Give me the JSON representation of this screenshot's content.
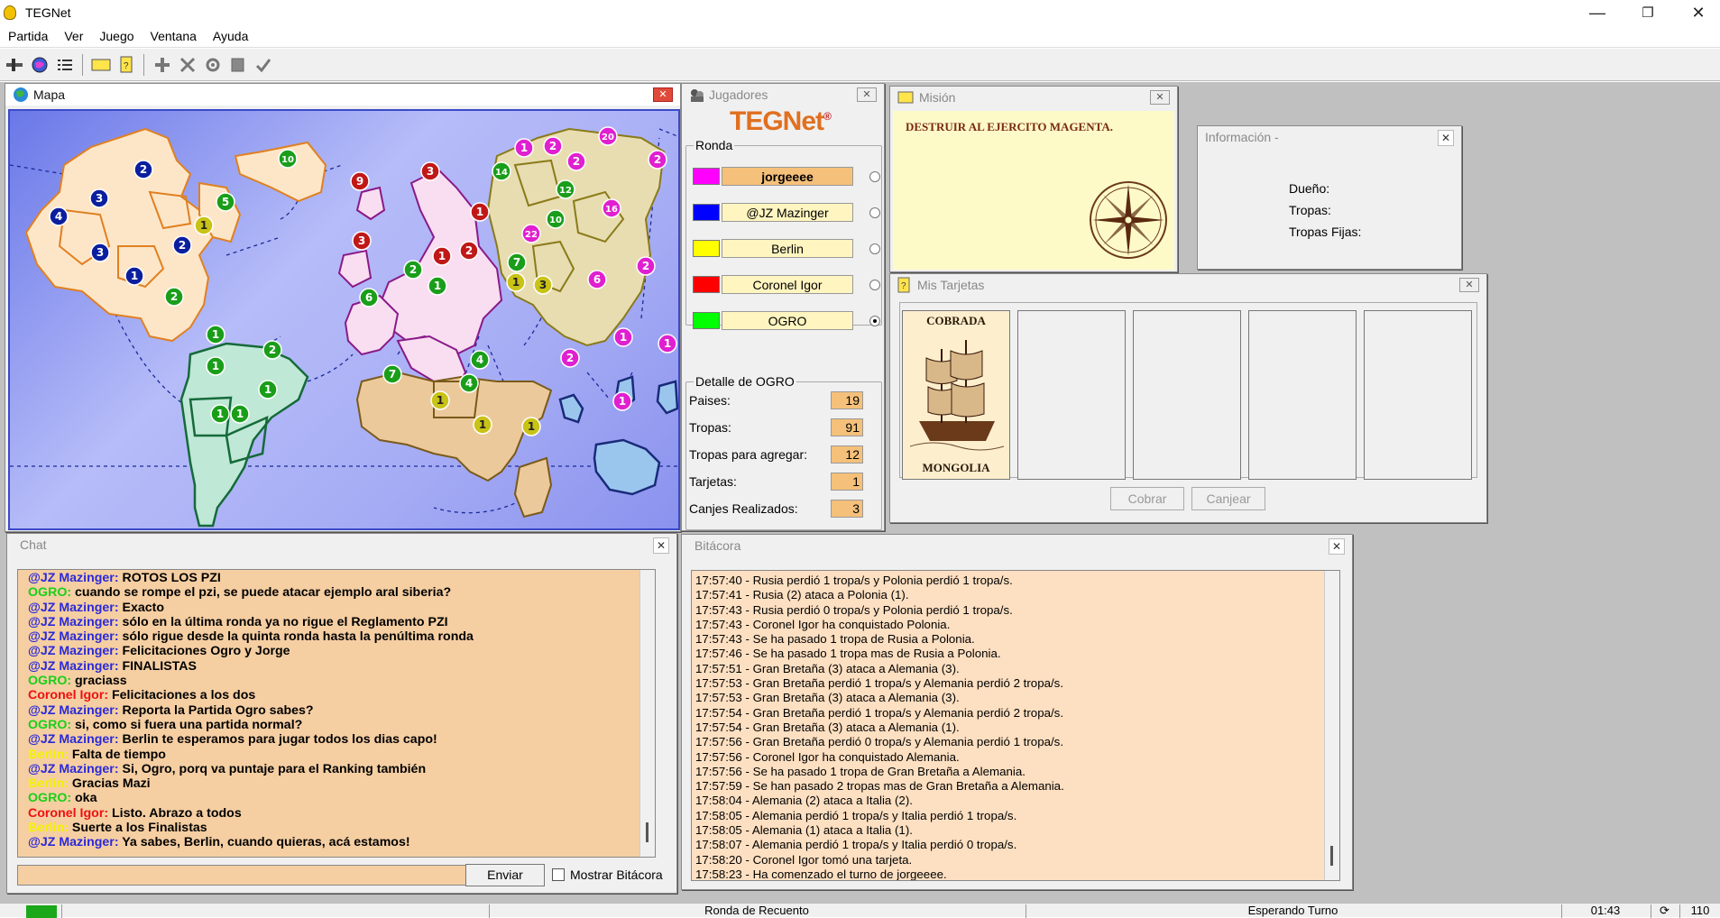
{
  "window": {
    "title": "TEGNet",
    "minimize": "—",
    "restore": "❐",
    "close": "✕"
  },
  "menu": [
    "Partida",
    "Ver",
    "Juego",
    "Ventana",
    "Ayuda"
  ],
  "map_window": {
    "title": "Mapa"
  },
  "players_window": {
    "title": "Jugadores",
    "logo": "TEGNet",
    "logo_mark": "®",
    "round_label": "Ronda",
    "players": [
      {
        "name": "jorgeeee",
        "color": "#ff00ff",
        "current": true,
        "selected": false
      },
      {
        "name": "@JZ Mazinger",
        "color": "#0000ff",
        "current": false,
        "selected": false
      },
      {
        "name": "Berlin",
        "color": "#ffff00",
        "current": false,
        "selected": false
      },
      {
        "name": "Coronel Igor",
        "color": "#ff0000",
        "current": false,
        "selected": false
      },
      {
        "name": "OGRO",
        "color": "#00ff00",
        "current": false,
        "selected": true
      }
    ],
    "detail_label": "Detalle de OGRO",
    "details": [
      {
        "label": "Paises:",
        "value": "19"
      },
      {
        "label": "Tropas:",
        "value": "91"
      },
      {
        "label": "Tropas para agregar:",
        "value": "12"
      },
      {
        "label": "Tarjetas:",
        "value": "1"
      },
      {
        "label": "Canjes Realizados:",
        "value": "3"
      }
    ]
  },
  "mission_window": {
    "title": "Misión",
    "text": "DESTRUIR AL EJERCITO MAGENTA."
  },
  "info_window": {
    "title": "Información -",
    "owner_label": "Dueño:",
    "troops_label": "Tropas:",
    "fixed_troops_label": "Tropas Fijas:"
  },
  "cards_window": {
    "title": "Mis Tarjetas",
    "card": {
      "top": "COBRADA",
      "bottom": "MONGOLIA"
    },
    "cobrar_button": "Cobrar",
    "canjear_button": "Canjear"
  },
  "chat_window": {
    "title": "Chat",
    "messages": [
      {
        "author": "@JZ Mazinger:",
        "text": " ROTOS LOS PZI",
        "color": "#2a2ad8"
      },
      {
        "author": "OGRO:",
        "text": " cuando se rompe el pzi, se puede atacar ejemplo aral siberia?",
        "color": "#18d018"
      },
      {
        "author": "@JZ Mazinger:",
        "text": " Exacto",
        "color": "#2a2ad8"
      },
      {
        "author": "@JZ Mazinger:",
        "text": " sólo en la última ronda ya no rigue el Reglamento PZI",
        "color": "#2a2ad8"
      },
      {
        "author": "@JZ Mazinger:",
        "text": " sólo rigue desde la quinta ronda hasta la penúltima ronda",
        "color": "#2a2ad8"
      },
      {
        "author": "@JZ Mazinger:",
        "text": " Felicitaciones Ogro y Jorge",
        "color": "#2a2ad8"
      },
      {
        "author": "@JZ Mazinger:",
        "text": " FINALISTAS",
        "color": "#2a2ad8"
      },
      {
        "author": "OGRO:",
        "text": " graciass",
        "color": "#18d018"
      },
      {
        "author": "Coronel Igor:",
        "text": " Felicitaciones a los dos",
        "color": "#ee1111"
      },
      {
        "author": "@JZ Mazinger:",
        "text": " Reporta la Partida Ogro sabes?",
        "color": "#2a2ad8"
      },
      {
        "author": "OGRO:",
        "text": " si, como si fuera una partida normal?",
        "color": "#18d018"
      },
      {
        "author": "@JZ Mazinger:",
        "text": " Berlin te esperamos para jugar todos los dias capo!",
        "color": "#2a2ad8"
      },
      {
        "author": "Berlin:",
        "text": " Falta de tiempo",
        "color": "#f4f400"
      },
      {
        "author": "@JZ Mazinger:",
        "text": " Si, Ogro, porq va puntaje para el Ranking también",
        "color": "#2a2ad8"
      },
      {
        "author": "Berlin:",
        "text": " Gracias Mazi",
        "color": "#f4f400"
      },
      {
        "author": "OGRO:",
        "text": " oka",
        "color": "#18d018"
      },
      {
        "author": "Coronel Igor:",
        "text": " Listo. Abrazo a todos",
        "color": "#ee1111"
      },
      {
        "author": "Berlin:",
        "text": " Suerte a los Finalistas",
        "color": "#f4f400"
      },
      {
        "author": "@JZ Mazinger:",
        "text": " Ya sabes, Berlin, cuando quieras, acá estamos!",
        "color": "#2a2ad8"
      }
    ],
    "input_value": "",
    "send_button": "Enviar",
    "show_log_label": "Mostrar Bitácora"
  },
  "log_window": {
    "title": "Bitácora",
    "entries": [
      "17:57:40 - Rusia perdió 1 tropa/s y Polonia perdió 1 tropa/s.",
      "17:57:41 - Rusia (2) ataca a Polonia (1).",
      "17:57:43 - Rusia perdió 0 tropa/s y Polonia perdió 1 tropa/s.",
      "17:57:43 - Coronel Igor ha conquistado Polonia.",
      "17:57:43 - Se ha pasado 1 tropa de Rusia a Polonia.",
      "17:57:46 - Se ha pasado 1 tropa mas de Rusia a Polonia.",
      "17:57:51 - Gran Bretaña (3) ataca a Alemania (3).",
      "17:57:53 - Gran Bretaña perdió 1 tropa/s y Alemania perdió 2 tropa/s.",
      "17:57:53 - Gran Bretaña (3) ataca a Alemania (3).",
      "17:57:54 - Gran Bretaña perdió 1 tropa/s y Alemania perdió 2 tropa/s.",
      "17:57:54 - Gran Bretaña (3) ataca a Alemania (1).",
      "17:57:56 - Gran Bretaña perdió 0 tropa/s y Alemania perdió 1 tropa/s.",
      "17:57:56 - Coronel Igor ha conquistado Alemania.",
      "17:57:56 - Se ha pasado 1 tropa de Gran Bretaña a Alemania.",
      "17:57:59 - Se han pasado 2 tropas mas de Gran Bretaña a Alemania.",
      "17:58:04 - Alemania (2) ataca a Italia (2).",
      "17:58:05 - Alemania perdió 1 tropa/s y Italia perdió 1 tropa/s.",
      "17:58:05 - Alemania (1) ataca a Italia (1).",
      "17:58:07 - Alemania perdió 1 tropa/s y Italia perdió 0 tropa/s.",
      "17:58:20 - Coronel Igor tomó una tarjeta.",
      "17:58:23 - Ha comenzado el turno de jorgeeee."
    ]
  },
  "statusbar": {
    "phase": "Ronda de Recuento",
    "state": "Esperando Turno",
    "time": "01:43",
    "count": "110"
  },
  "map": {
    "armies": [
      {
        "n": "2",
        "c": "#0b1f9e"
      },
      {
        "n": "3",
        "c": "#0b1f9e"
      },
      {
        "n": "4",
        "c": "#0b1f9e"
      },
      {
        "n": "3",
        "c": "#0b1f9e"
      },
      {
        "n": "2",
        "c": "#0b1f9e"
      },
      {
        "n": "1",
        "c": "#0b1f9e"
      },
      {
        "n": "5",
        "c": "#1a9e1a"
      },
      {
        "n": "1",
        "c": "#c9c217"
      },
      {
        "n": "2",
        "c": "#1a9e1a"
      },
      {
        "n": "10",
        "c": "#1a9e1a"
      },
      {
        "n": "9",
        "c": "#c01818"
      },
      {
        "n": "3",
        "c": "#c01818"
      },
      {
        "n": "3",
        "c": "#c01818"
      },
      {
        "n": "1",
        "c": "#c01818"
      },
      {
        "n": "1",
        "c": "#c01818"
      },
      {
        "n": "2",
        "c": "#c01818"
      },
      {
        "n": "2",
        "c": "#1a9e1a"
      },
      {
        "n": "6",
        "c": "#1a9e1a"
      },
      {
        "n": "1",
        "c": "#1a9e1a"
      },
      {
        "n": "7",
        "c": "#1a9e1a"
      },
      {
        "n": "1",
        "c": "#c9c217"
      },
      {
        "n": "3",
        "c": "#c9c217"
      },
      {
        "n": "22",
        "c": "#e020d0"
      },
      {
        "n": "14",
        "c": "#1a9e1a"
      },
      {
        "n": "1",
        "c": "#e020d0"
      },
      {
        "n": "2",
        "c": "#e020d0"
      },
      {
        "n": "20",
        "c": "#e020d0"
      },
      {
        "n": "2",
        "c": "#e020d0"
      },
      {
        "n": "2",
        "c": "#e020d0"
      },
      {
        "n": "12",
        "c": "#1a9e1a"
      },
      {
        "n": "10",
        "c": "#1a9e1a"
      },
      {
        "n": "16",
        "c": "#e020d0"
      },
      {
        "n": "6",
        "c": "#e020d0"
      },
      {
        "n": "2",
        "c": "#e020d0"
      },
      {
        "n": "1",
        "c": "#1a9e1a"
      },
      {
        "n": "2",
        "c": "#1a9e1a"
      },
      {
        "n": "1",
        "c": "#1a9e1a"
      },
      {
        "n": "1",
        "c": "#1a9e1a"
      },
      {
        "n": "1",
        "c": "#1a9e1a"
      },
      {
        "n": "1",
        "c": "#1a9e1a"
      },
      {
        "n": "7",
        "c": "#1a9e1a"
      },
      {
        "n": "4",
        "c": "#1a9e1a"
      },
      {
        "n": "4",
        "c": "#1a9e1a"
      },
      {
        "n": "1",
        "c": "#c9c217"
      },
      {
        "n": "1",
        "c": "#c9c217"
      },
      {
        "n": "1",
        "c": "#c9c217"
      },
      {
        "n": "1",
        "c": "#e020d0"
      },
      {
        "n": "2",
        "c": "#e020d0"
      },
      {
        "n": "1",
        "c": "#e020d0"
      },
      {
        "n": "1",
        "c": "#e020d0"
      }
    ]
  }
}
